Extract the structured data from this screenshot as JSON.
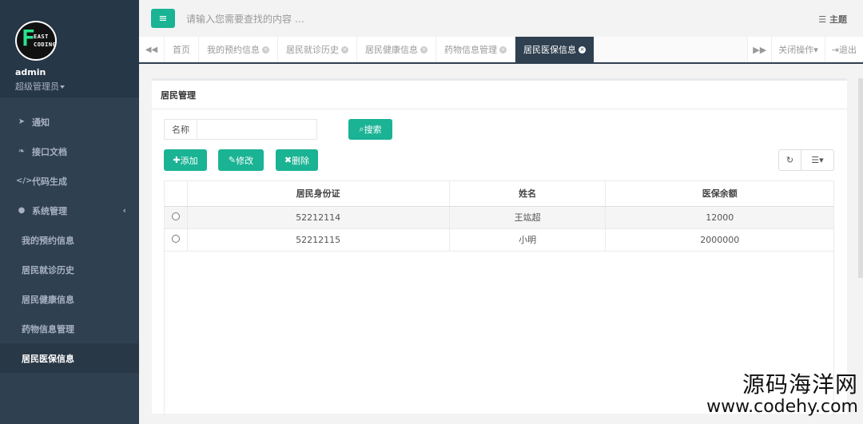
{
  "sidebar": {
    "logo_big": "F",
    "logo_line1": "EAST",
    "logo_line2": "CODING",
    "username": "admin",
    "role": "超级管理员",
    "items": [
      {
        "label": "通知",
        "icon": "send-icon"
      },
      {
        "label": "接口文档",
        "icon": "leaf-icon"
      },
      {
        "label": "代码生成",
        "icon": "code-icon"
      },
      {
        "label": "系统管理",
        "icon": "user-icon"
      }
    ],
    "sub_items": [
      {
        "label": "我的预约信息"
      },
      {
        "label": "居民就诊历史"
      },
      {
        "label": "居民健康信息"
      },
      {
        "label": "药物信息管理"
      },
      {
        "label": "居民医保信息"
      }
    ]
  },
  "topbar": {
    "search_placeholder": "请输入您需要查找的内容 …",
    "theme_label": "主题"
  },
  "tabs": [
    {
      "label": "首页",
      "closable": false
    },
    {
      "label": "我的预约信息",
      "closable": true
    },
    {
      "label": "居民就诊历史",
      "closable": true
    },
    {
      "label": "居民健康信息",
      "closable": true
    },
    {
      "label": "药物信息管理",
      "closable": true
    },
    {
      "label": "居民医保信息",
      "closable": true
    }
  ],
  "tab_actions": {
    "close_ops": "关闭操作",
    "logout": "退出"
  },
  "panel": {
    "title": "居民管理",
    "name_label": "名称",
    "search_button": "搜索",
    "add_button": "添加",
    "edit_button": "修改",
    "delete_button": "删除"
  },
  "table": {
    "columns": [
      "居民身份证",
      "姓名",
      "医保余额"
    ],
    "rows": [
      [
        "52212114",
        "王竑超",
        "12000"
      ],
      [
        "52212115",
        "小明",
        "2000000"
      ]
    ]
  },
  "watermark": {
    "cn": "源码海洋网",
    "url": "www.codehy.com"
  }
}
